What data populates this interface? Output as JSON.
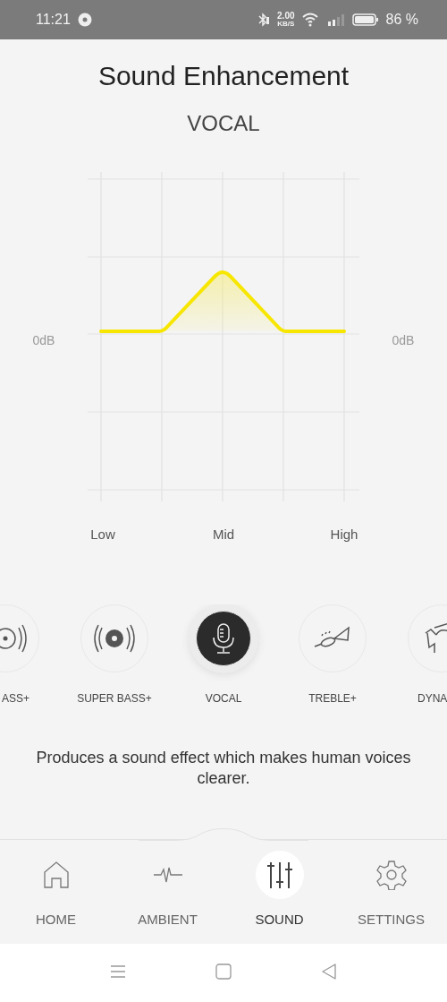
{
  "status_bar": {
    "time": "11:21",
    "speed": "2.00",
    "speed_unit": "KB/S",
    "battery": "86 %"
  },
  "title": "Sound Enhancement",
  "preset_name": "VOCAL",
  "eq": {
    "left_label": "0dB",
    "right_label": "0dB",
    "x_labels": [
      "Low",
      "Mid",
      "High"
    ]
  },
  "presets": [
    {
      "label": "ASS+",
      "kind": "disc",
      "selected": false
    },
    {
      "label": "SUPER BASS+",
      "kind": "speaker",
      "selected": false
    },
    {
      "label": "VOCAL",
      "kind": "microphone",
      "selected": true
    },
    {
      "label": "TREBLE+",
      "kind": "trumpet",
      "selected": false
    },
    {
      "label": "DYNA",
      "kind": "figure",
      "selected": false
    }
  ],
  "description": "Produces a sound effect which makes human voices clearer.",
  "nav": [
    {
      "label": "HOME",
      "kind": "home",
      "selected": false
    },
    {
      "label": "AMBIENT",
      "kind": "pulse",
      "selected": false
    },
    {
      "label": "SOUND",
      "kind": "sliders",
      "selected": true
    },
    {
      "label": "SETTINGS",
      "kind": "gear",
      "selected": false
    }
  ]
}
